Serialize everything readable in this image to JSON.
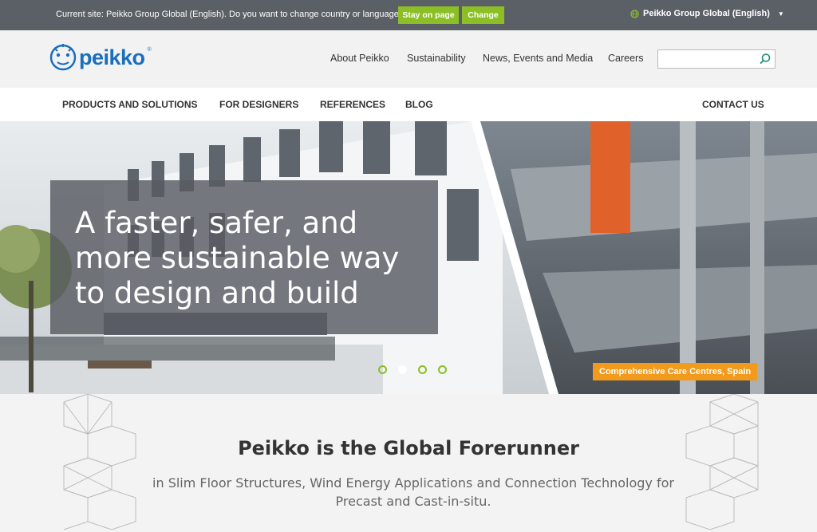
{
  "topbar": {
    "notice": "Current site: Peikko Group Global (English). Do you want to change country or language?",
    "stay_label": "Stay on page",
    "change_label": "Change",
    "language_label": "Peikko Group Global (English)"
  },
  "header": {
    "logo_text": "peikko",
    "logo_mark": "®",
    "top_nav": [
      "About Peikko",
      "Sustainability",
      "News, Events and Media",
      "Careers"
    ],
    "search_placeholder": ""
  },
  "main_nav": {
    "items": [
      "PRODUCTS AND SOLUTIONS",
      "FOR DESIGNERS",
      "REFERENCES",
      "BLOG"
    ],
    "contact": "CONTACT US"
  },
  "hero": {
    "title": "A faster, safer, and more sustainable way to design and build",
    "caption": "Comprehensive Care Centres, Spain",
    "slides_total": 4,
    "active_slide": 2
  },
  "intro": {
    "title": "Peikko is the Global Forerunner",
    "subtitle": "in Slim Floor Structures, Wind Energy Applications and Connection Technology for Precast and Cast-in-situ."
  },
  "colors": {
    "topbar_bg": "#5b6066",
    "accent_green": "#8cbf26",
    "brand_blue": "#1a6ebd",
    "caption_orange": "#f29a1c"
  }
}
